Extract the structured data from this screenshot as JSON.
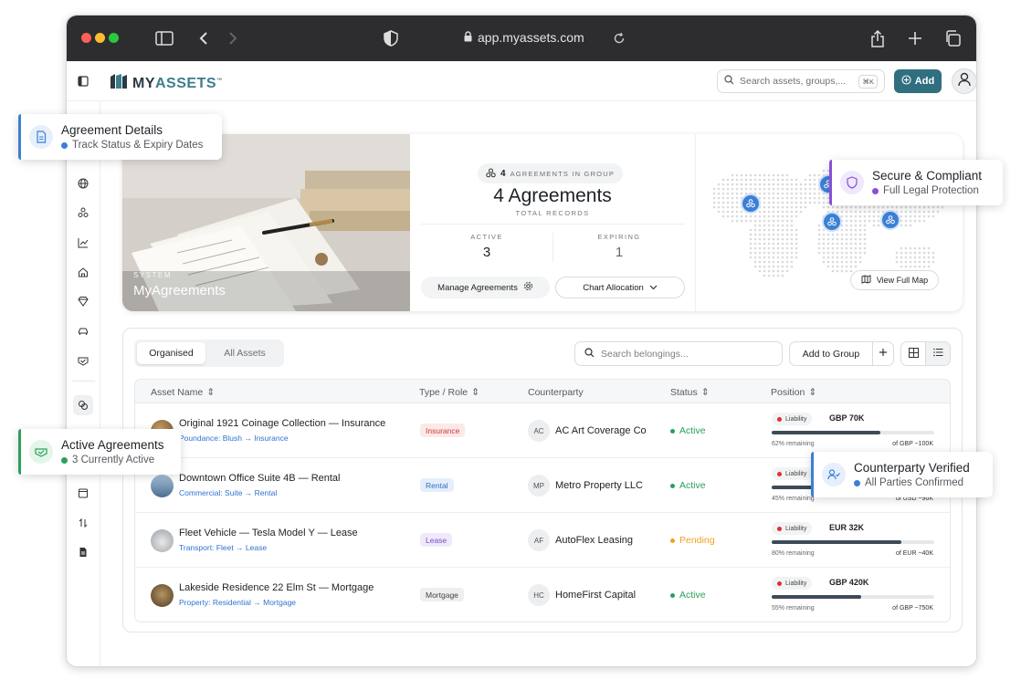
{
  "browser": {
    "url": "app.myassets.com"
  },
  "app": {
    "logo": {
      "my": "MY",
      "assets": "ASSETS",
      "tm": "™"
    },
    "search": {
      "placeholder": "Search assets, groups,...",
      "shortcut": "⌘K"
    },
    "add_label": "Add"
  },
  "hero": {
    "caption_kicker": "SYSTEM",
    "caption_title": "MyAgreements",
    "group_count": "4",
    "group_label": "AGREEMENTS IN GROUP",
    "total": "4 Agreements",
    "total_sub": "TOTAL RECORDS",
    "active_label": "ACTIVE",
    "active_value": "3",
    "expiring_label": "EXPIRING",
    "expiring_value": "1",
    "manage_label": "Manage Agreements",
    "chart_label": "Chart Allocation",
    "map_label": "View Full Map"
  },
  "table": {
    "tabs": [
      "Organised",
      "All Assets"
    ],
    "search_placeholder": "Search belongings...",
    "add_group_label": "Add to Group",
    "columns": [
      "Asset Name",
      "Type / Role",
      "Counterparty",
      "Status",
      "Position"
    ],
    "rows": [
      {
        "name": "Original 1921 Coinage Collection — Insurance",
        "path": "Poundance: Blush → Insurance",
        "type": "Insurance",
        "cp_initials": "AC",
        "cp_name": "AC Art Coverage Co",
        "status": "Active",
        "liability": "Liability",
        "amount": "GBP 70K",
        "remaining": "62% remaining",
        "of_total": "of GBP ~100K",
        "fill": 0.67
      },
      {
        "name": "Downtown Office Suite 4B — Rental",
        "path": "Commercial: Suite → Rental",
        "type": "Rental",
        "cp_initials": "MP",
        "cp_name": "Metro Property LLC",
        "status": "Active",
        "liability": "Liability",
        "amount": "",
        "remaining": "45% remaining",
        "of_total": "of USD ~96K",
        "fill": 0.45
      },
      {
        "name": "Fleet Vehicle — Tesla Model Y — Lease",
        "path": "Transport: Fleet → Lease",
        "type": "Lease",
        "cp_initials": "AF",
        "cp_name": "AutoFlex Leasing",
        "status": "Pending",
        "liability": "Liability",
        "amount": "EUR 32K",
        "remaining": "80% remaining",
        "of_total": "of EUR ~40K",
        "fill": 0.8
      },
      {
        "name": "Lakeside Residence 22 Elm St — Mortgage",
        "path": "Property: Residential → Mortgage",
        "type": "Mortgage",
        "cp_initials": "HC",
        "cp_name": "HomeFirst Capital",
        "status": "Active",
        "liability": "Liability",
        "amount": "GBP 420K",
        "remaining": "55% remaining",
        "of_total": "of GBP ~750K",
        "fill": 0.55
      }
    ]
  },
  "callouts": {
    "agreement": {
      "title": "Agreement Details",
      "sub": "Track Status & Expiry Dates"
    },
    "secure": {
      "title": "Secure & Compliant",
      "sub": "Full Legal Protection"
    },
    "active": {
      "title": "Active Agreements",
      "sub": "3 Currently Active"
    },
    "counterparty": {
      "title": "Counterparty Verified",
      "sub": "All Parties Confirmed"
    }
  },
  "colors": {
    "accent": "#2f6f80",
    "active": "#2aa05a",
    "pending": "#f0a020",
    "link": "#2f73d0",
    "pin": "#3b7fd6"
  }
}
